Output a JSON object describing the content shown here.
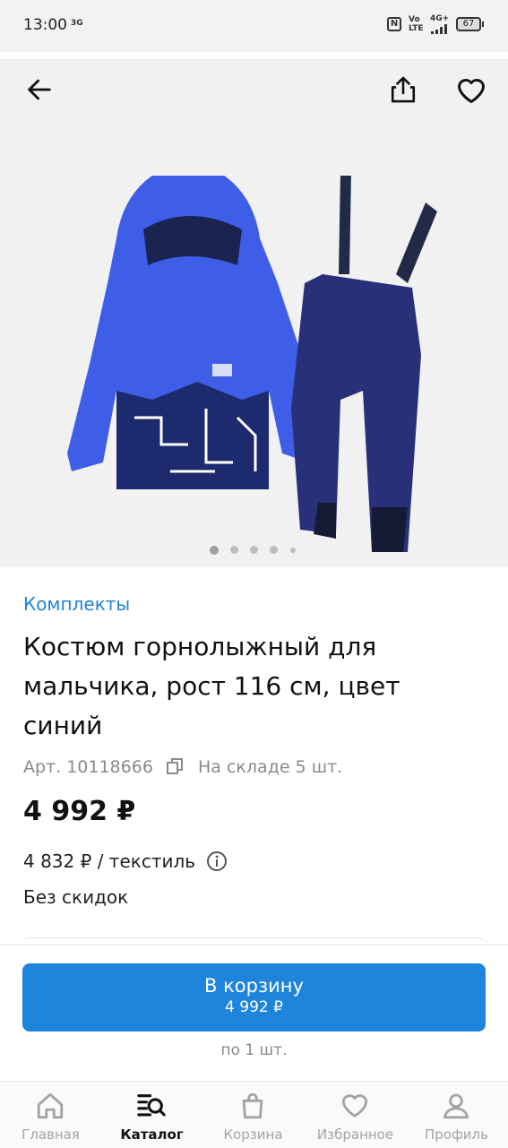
{
  "status_bar": {
    "time": "13:00",
    "network_small": "3G",
    "volte": "Vo\nLTE",
    "signal_type": "4G+",
    "battery": "67"
  },
  "gallery": {
    "image_count": 5,
    "active_index": 0,
    "icons": {
      "back": "arrow-left-icon",
      "share": "share-icon",
      "favorite": "heart-icon"
    }
  },
  "product": {
    "category": "Комплекты",
    "title": "Костюм горнолыжный для мальчика, рост 116 см, цвет синий",
    "article": "Арт. 10118666",
    "stock": "На складе 5 шт.",
    "price": "4 992 ₽",
    "unit_price": "4 832 ₽ / текстиль",
    "discount": "Без скидок"
  },
  "cart": {
    "button_label": "В корзину",
    "button_price": "4 992 ₽",
    "quantity_note": "по 1 шт."
  },
  "tabs": [
    {
      "label": "Главная",
      "icon": "home-icon",
      "active": false
    },
    {
      "label": "Каталог",
      "icon": "catalog-search-icon",
      "active": true
    },
    {
      "label": "Корзина",
      "icon": "shopping-bag-icon",
      "active": false
    },
    {
      "label": "Избранное",
      "icon": "heart-icon",
      "active": false
    },
    {
      "label": "Профиль",
      "icon": "user-icon",
      "active": false
    }
  ],
  "colors": {
    "accent": "#1f84dc",
    "link": "#1f83d9",
    "muted": "#8a8a8a"
  }
}
